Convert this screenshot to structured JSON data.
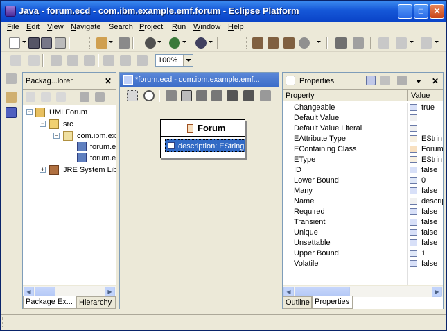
{
  "window": {
    "title": "Java - forum.ecd - com.ibm.example.emf.forum - Eclipse Platform"
  },
  "menubar": [
    {
      "label": "File",
      "mnemonic": "F",
      "rest": "ile"
    },
    {
      "label": "Edit",
      "mnemonic": "E",
      "rest": "dit"
    },
    {
      "label": "View",
      "mnemonic": "V",
      "rest": "iew"
    },
    {
      "label": "Navigate",
      "mnemonic": "N",
      "rest": "avigate"
    },
    {
      "label": "Search",
      "mnemonic": "",
      "rest": "Search"
    },
    {
      "label": "Project",
      "mnemonic": "P",
      "rest": "roject"
    },
    {
      "label": "Run",
      "mnemonic": "R",
      "rest": "un"
    },
    {
      "label": "Window",
      "mnemonic": "W",
      "rest": "indow"
    },
    {
      "label": "Help",
      "mnemonic": "H",
      "rest": "elp"
    }
  ],
  "toolbar": {
    "zoom": "100%"
  },
  "package_explorer": {
    "title": "Packag...lorer",
    "tree": [
      "UMLForum",
      "src",
      "com.ibm.ex",
      "forum.e",
      "forum.e",
      "JRE System Libr"
    ],
    "tabs": [
      "Package Ex...",
      "Hierarchy"
    ]
  },
  "editor": {
    "tab": "*forum.ecd - com.ibm.example.emf...",
    "class_box": {
      "name": "Forum",
      "attribute": "description: EString"
    }
  },
  "properties": {
    "title": "Properties",
    "columns": [
      "Property",
      "Value"
    ],
    "rows": [
      {
        "name": "Changeable",
        "value": "true",
        "icon": "boolean-icon"
      },
      {
        "name": "Default Value",
        "value": "",
        "icon": "text-icon"
      },
      {
        "name": "Default Value Literal",
        "value": "",
        "icon": "text-icon"
      },
      {
        "name": "EAttribute Type",
        "value": "EStrin",
        "icon": "datatype-icon"
      },
      {
        "name": "EContaining Class",
        "value": "Forum",
        "icon": "class-icon"
      },
      {
        "name": "EType",
        "value": "EStrin",
        "icon": "datatype-icon"
      },
      {
        "name": "ID",
        "value": "false",
        "icon": "boolean-icon"
      },
      {
        "name": "Lower Bound",
        "value": "0",
        "icon": "int-icon"
      },
      {
        "name": "Many",
        "value": "false",
        "icon": "boolean-icon"
      },
      {
        "name": "Name",
        "value": "descrip",
        "icon": "text-icon"
      },
      {
        "name": "Required",
        "value": "false",
        "icon": "boolean-icon"
      },
      {
        "name": "Transient",
        "value": "false",
        "icon": "boolean-icon"
      },
      {
        "name": "Unique",
        "value": "false",
        "icon": "boolean-icon"
      },
      {
        "name": "Unsettable",
        "value": "false",
        "icon": "boolean-icon"
      },
      {
        "name": "Upper Bound",
        "value": "1",
        "icon": "int-icon"
      },
      {
        "name": "Volatile",
        "value": "false",
        "icon": "boolean-icon"
      }
    ],
    "tabs": [
      "Outline",
      "Properties"
    ]
  },
  "colors": {
    "titlebar": "#0a44c8",
    "selection": "#316ac5",
    "class_box_header": "#ffffff"
  }
}
